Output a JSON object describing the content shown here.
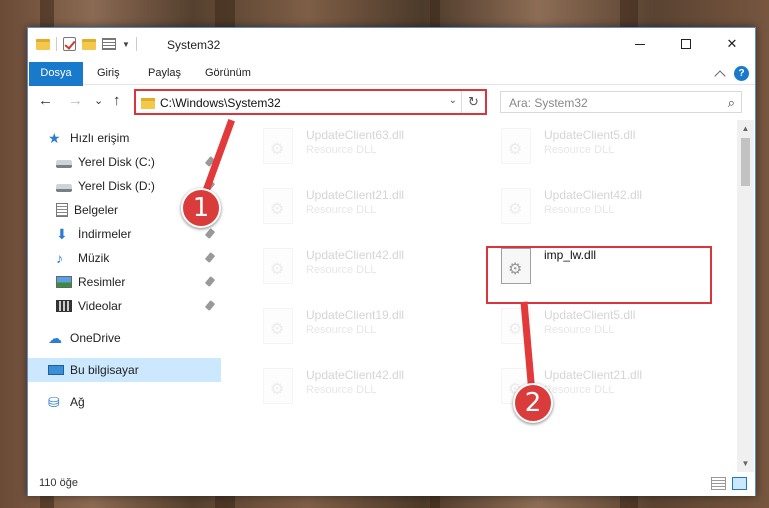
{
  "window": {
    "title": "System32",
    "min_icon": "minimize-icon",
    "max_icon": "maximize-icon",
    "close_label": "✕"
  },
  "ribbon": {
    "tabs": [
      {
        "label": "Dosya"
      },
      {
        "label": "Giriş"
      },
      {
        "label": "Paylaş"
      },
      {
        "label": "Görünüm"
      }
    ],
    "help_label": "?"
  },
  "nav": {
    "back": "←",
    "forward": "→",
    "recent": "⌄",
    "up": "↑",
    "address": "C:\\Windows\\System32",
    "dropdown": "⌄",
    "refresh": "↻",
    "search_placeholder": "Ara: System32",
    "search_icon": "⌕"
  },
  "sidebar": {
    "items": [
      {
        "label": "Hızlı erişim",
        "icon": "star-icon",
        "glyph": "★"
      },
      {
        "label": "Yerel Disk (C:)",
        "icon": "drive-icon"
      },
      {
        "label": "Yerel Disk (D:)",
        "icon": "drive-icon"
      },
      {
        "label": "Belgeler",
        "icon": "document-icon"
      },
      {
        "label": "İndirmeler",
        "icon": "download-icon",
        "glyph": "⬇"
      },
      {
        "label": "Müzik",
        "icon": "music-icon",
        "glyph": "♪"
      },
      {
        "label": "Resimler",
        "icon": "pictures-icon"
      },
      {
        "label": "Videolar",
        "icon": "videos-icon"
      },
      {
        "label": "OneDrive",
        "icon": "cloud-icon",
        "glyph": "☁"
      },
      {
        "label": "Bu bilgisayar",
        "icon": "computer-icon"
      },
      {
        "label": "Ağ",
        "icon": "network-icon",
        "glyph": "⛁"
      }
    ]
  },
  "files": [
    {
      "name": "UpdateClient63.dll",
      "type": "Resource DLL"
    },
    {
      "name": "UpdateClient5.dll",
      "type": "Resource DLL"
    },
    {
      "name": "UpdateClient21.dll",
      "type": "Resource DLL"
    },
    {
      "name": "UpdateClient42.dll",
      "type": "Resource DLL"
    },
    {
      "name": "UpdateClient42.dll",
      "type": "Resource DLL"
    },
    {
      "name": "imp_lw.dll",
      "type": ""
    },
    {
      "name": "UpdateClient19.dll",
      "type": "Resource DLL"
    },
    {
      "name": "UpdateClient5.dll",
      "type": "Resource DLL"
    },
    {
      "name": "UpdateClient42.dll",
      "type": "Resource DLL"
    },
    {
      "name": "UpdateClient21.dll",
      "type": "Resource DLL"
    }
  ],
  "status": {
    "count": "110 öğe"
  },
  "annotations": {
    "step1": "1",
    "step2": "2"
  },
  "colors": {
    "accent": "#1979ca",
    "highlight": "#d9353b",
    "selected": "#cce8ff"
  }
}
